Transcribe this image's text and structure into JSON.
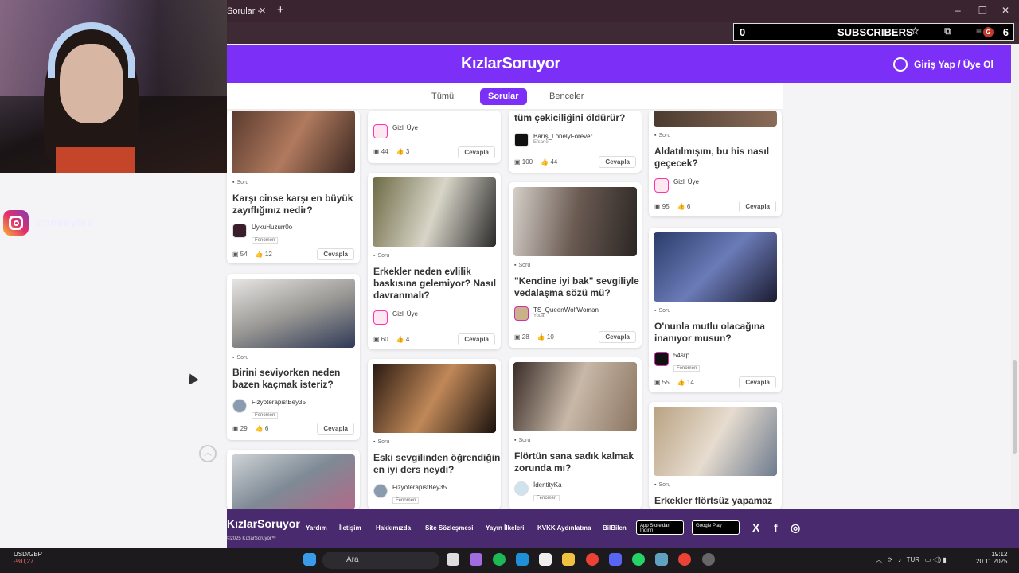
{
  "overlay": {
    "instagram_handle": "chessyise",
    "subscribers": {
      "count": "0",
      "label": "SUBSCRIBERS",
      "right_count": "6",
      "badge": "G"
    }
  },
  "browser": {
    "tab_title": "Sorular -",
    "close_glyph": "✕",
    "new_tab_glyph": "+",
    "win_controls": [
      "–",
      "❐",
      "✕"
    ]
  },
  "site": {
    "logo": "KızlarSoruyor",
    "login": "Giriş Yap / Üye Ol",
    "tabs": [
      "Tümü",
      "Sorular",
      "Benceler"
    ],
    "active_tab": "Sorular",
    "soru_label": "Soru",
    "reply_label": "Cevapla",
    "cards": [
      {
        "title": "Karşı cinse karşı en büyük zayıflığınız nedir?",
        "user": "UykuHuzurr0o",
        "badge": "Fenomen",
        "comments": "54",
        "likes": "12"
      },
      {
        "title": "Birini seviyorken neden bazen kaçmak isteriz?",
        "user": "FizyoterapistBey35",
        "badge": "Fenomen",
        "comments": "29",
        "likes": "6"
      },
      {
        "title": "",
        "user": "Gizli Üye",
        "badge": "",
        "comments": "44",
        "likes": "3"
      },
      {
        "title": "Erkekler neden evlilik baskısına gelemiyor? Nasıl davranmalı?",
        "user": "Gizli Üye",
        "badge": "",
        "comments": "60",
        "likes": "4"
      },
      {
        "title": "Eski sevgilinden öğrendiğin en iyi ders neydi?",
        "user": "FizyoterapistBey35",
        "badge": "Fenomen",
        "comments": "",
        "likes": ""
      },
      {
        "title": "tüm çekiciliğini öldürür?",
        "user": "Barış_LonelyForever",
        "badge": "Efsane",
        "comments": "100",
        "likes": "44"
      },
      {
        "title": "\"Kendine iyi bak\" sevgiliyle vedalaşma sözü mü?",
        "user": "TS_QueenWolfWoman",
        "badge": "Yoda",
        "comments": "28",
        "likes": "10"
      },
      {
        "title": "Flörtün sana sadık kalmak zorunda mı?",
        "user": "İdentityKa",
        "badge": "Fenomen",
        "comments": "",
        "likes": ""
      },
      {
        "title": "Aldatılmışım, bu his nasıl geçecek?",
        "user": "Gizli Üye",
        "badge": "",
        "comments": "95",
        "likes": "6"
      },
      {
        "title": "O'nunla mutlu olacağına inanıyor musun?",
        "user": "54srp",
        "badge": "Fenomen",
        "comments": "55",
        "likes": "14"
      },
      {
        "title": "Erkekler flörtsüz yapamaz",
        "user": "",
        "badge": "",
        "comments": "",
        "likes": ""
      }
    ]
  },
  "footer": {
    "logo": "KızlarSoruyor",
    "copyright": "©2025 KızlarSoruyor™",
    "links": [
      "Yardım",
      "İletişim",
      "Hakkımızda",
      "Site Sözleşmesi",
      "Yayın İlkeleri",
      "KVKK Aydınlatma",
      "BilBilen"
    ],
    "app_store": "App Store'dan İndirin",
    "google_play": "Google Play",
    "social": [
      "X",
      "f",
      "◎"
    ]
  },
  "taskbar": {
    "ticker_pair": "USD/GBP",
    "ticker_change": "-%0,27",
    "search_placeholder": "Ara",
    "language": "TUR",
    "time": "19:12",
    "date": "20.11.2025"
  },
  "colors": {
    "brand": "#7b2ff7",
    "footer": "#4a2a6e",
    "taskbar": "#1c1a1d"
  }
}
